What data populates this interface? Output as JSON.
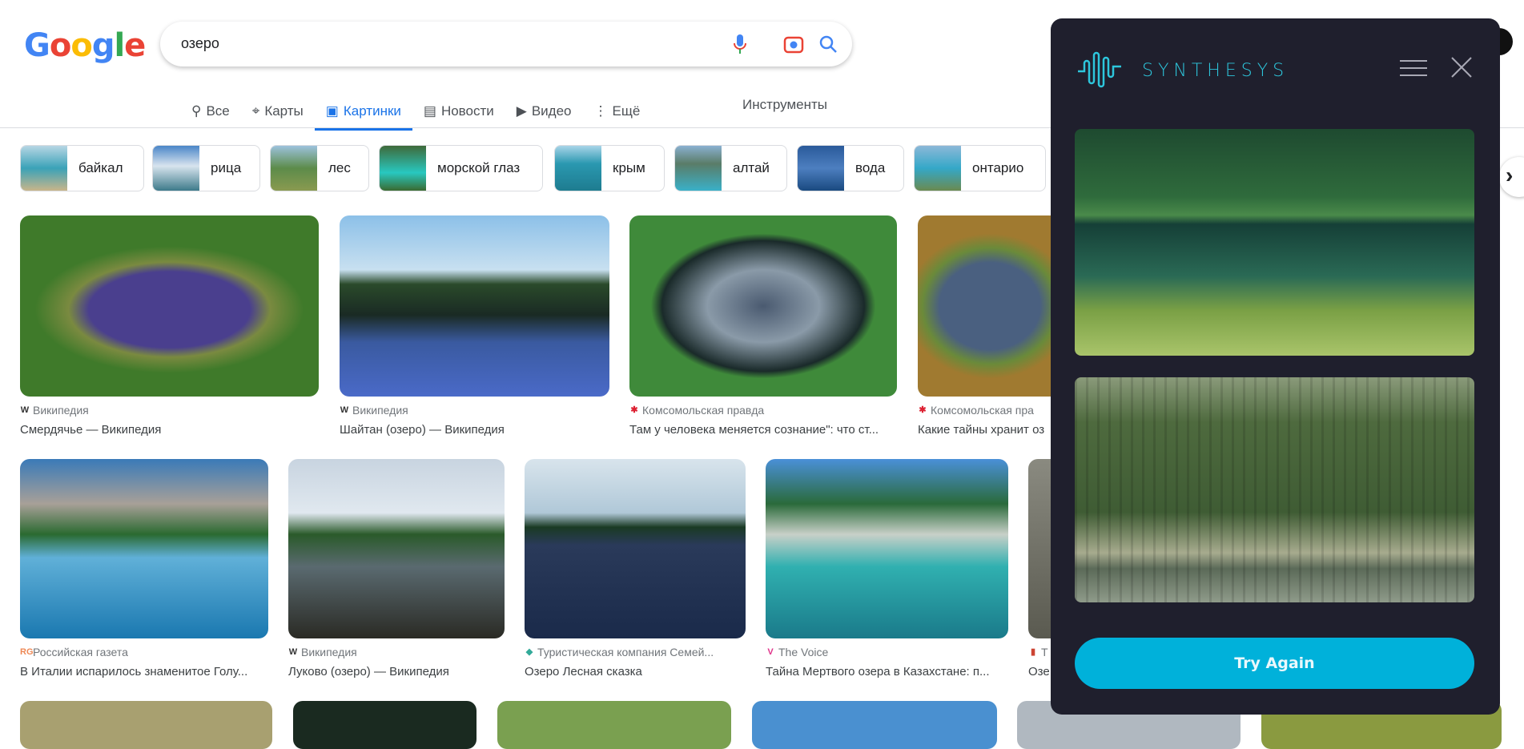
{
  "header": {
    "logo": "Google",
    "query": "озеро",
    "icons": [
      "mic-icon",
      "camera-lens-icon",
      "search-icon"
    ]
  },
  "tabs": [
    {
      "label": "Все",
      "icon": "search-icon"
    },
    {
      "label": "Карты",
      "icon": "pin-icon"
    },
    {
      "label": "Картинки",
      "icon": "image-icon",
      "active": true
    },
    {
      "label": "Новости",
      "icon": "news-icon"
    },
    {
      "label": "Видео",
      "icon": "play-icon"
    },
    {
      "label": "Ещё",
      "icon": "more-vert-icon"
    }
  ],
  "tools_label": "Инструменты",
  "chips": [
    "байкал",
    "рица",
    "лес",
    "морской глаз",
    "крым",
    "алтай",
    "вода",
    "онтарио"
  ],
  "results": [
    {
      "source": "Википедия",
      "title": "Смердячье — Википедия"
    },
    {
      "source": "Википедия",
      "title": "Шайтан (озеро) — Википедия"
    },
    {
      "source": "Комсомольская правда",
      "title": "Там у человека меняется сознание\": что ст..."
    },
    {
      "source": "Комсомольская пра",
      "title": "Какие тайны хранит оз"
    },
    {
      "source": "Российская газета",
      "title": "В Италии испарилось знаменитое Голу..."
    },
    {
      "source": "Википедия",
      "title": "Луково (озеро) — Википедия"
    },
    {
      "source": "Туристическая компания Семей...",
      "title": "Озеро Лесная сказка"
    },
    {
      "source": "The Voice",
      "title": "Тайна Мертвого озера в Казахстане: п..."
    },
    {
      "source": "Т",
      "title": "Озе"
    }
  ],
  "panel": {
    "brand": "SYNTHESYS",
    "button": "Try Again",
    "accent": "#00b1da",
    "bg": "#1f1f2d"
  }
}
